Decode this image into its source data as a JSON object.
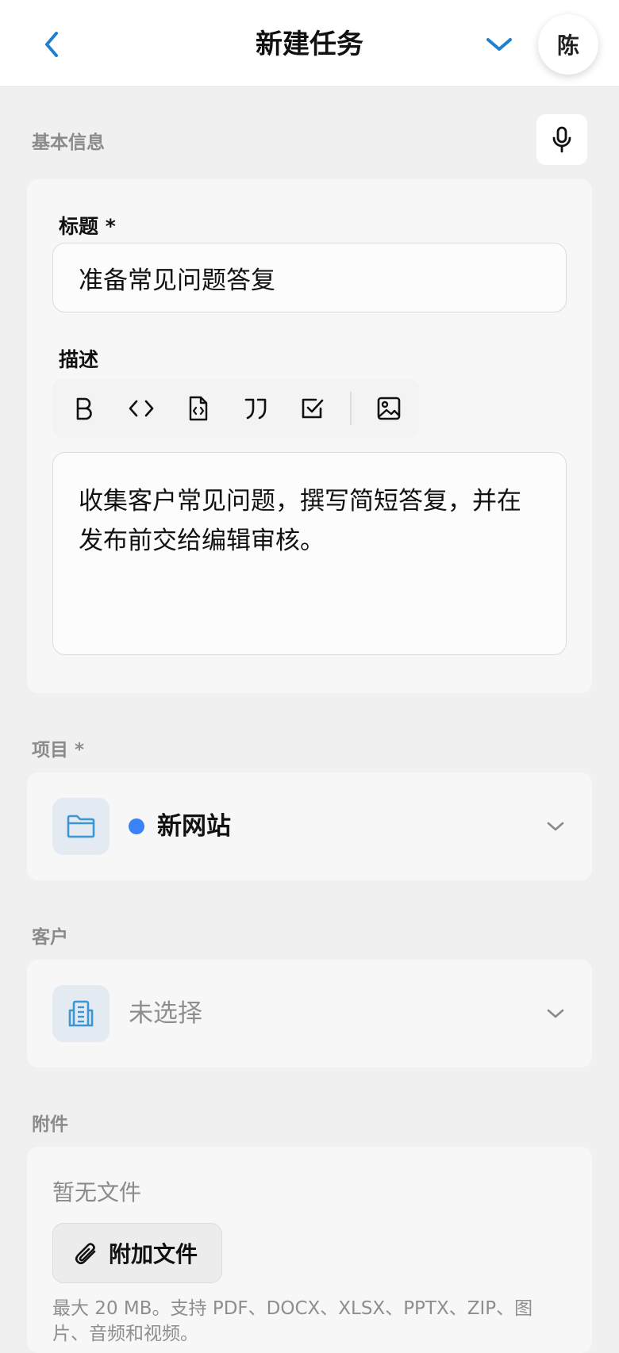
{
  "header": {
    "title": "新建任务",
    "avatar_text": "陈",
    "back_icon": "chevron-left-icon",
    "collapse_icon": "chevron-down-icon"
  },
  "basic_info": {
    "section_label": "基本信息",
    "mic_icon": "microphone-icon",
    "title_label": "标题 *",
    "title_value": "准备常见问题答复",
    "description_label": "描述",
    "toolbar": [
      "bold-icon",
      "code-icon",
      "code-file-icon",
      "quote-icon",
      "checkbox-icon",
      "image-icon"
    ],
    "description_value": "收集客户常见问题，撰写简短答复，并在发布前交给编辑审核。"
  },
  "project": {
    "section_label": "项目 *",
    "value": "新网站",
    "dot_color": "#3b82f6",
    "icon": "folder-icon"
  },
  "client": {
    "section_label": "客户",
    "value": "未选择",
    "icon": "building-icon"
  },
  "attachments": {
    "section_label": "附件",
    "empty_text": "暂无文件",
    "attach_button_label": "附加文件",
    "hint": "最大 20 MB。支持 PDF、DOCX、XLSX、PPTX、ZIP、图片、音频和视频。"
  },
  "colors": {
    "accent": "#1f7fd0",
    "background": "#f0f0f0",
    "card": "#f7f7f7"
  }
}
